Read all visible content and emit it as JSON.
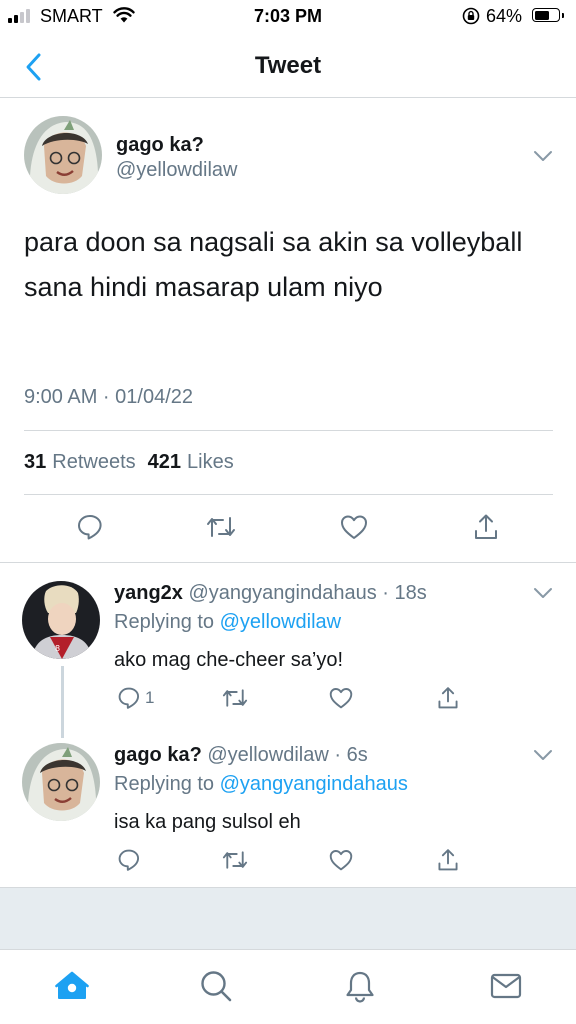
{
  "status_bar": {
    "carrier": "SMART",
    "time": "7:03 PM",
    "battery_percent": "64%",
    "battery_level": 0.64,
    "icons": [
      "signal-icon",
      "wifi-icon",
      "orientation-lock-icon",
      "battery-icon"
    ]
  },
  "nav": {
    "title": "Tweet",
    "back_icon": "chevron-left-icon"
  },
  "main_tweet": {
    "display_name": "gago ka?",
    "handle": "@yellowdilaw",
    "body": "para doon sa nagsali sa akin sa volleyball sana hindi masarap ulam niyo",
    "timestamp": "9:00 AM · 01/04/22",
    "retweets_count": "31",
    "retweets_label": "Retweets",
    "likes_count": "421",
    "likes_label": "Likes"
  },
  "replies": [
    {
      "display_name": "yang2x",
      "handle": "@yangyangindahaus · 18s",
      "replying_prefix": "Replying to ",
      "replying_to": "@yellowdilaw",
      "text": "ako mag che-cheer sa’yo!",
      "reply_count": "1"
    },
    {
      "display_name": "gago ka?",
      "handle": "@yellowdilaw · 6s",
      "replying_prefix": "Replying to ",
      "replying_to": "@yangyangindahaus",
      "text": "isa ka pang sulsol eh",
      "reply_count": ""
    }
  ],
  "tab_bar": {
    "tabs": [
      "home-icon",
      "search-icon",
      "notifications-icon",
      "messages-icon"
    ],
    "active": "home-icon"
  },
  "colors": {
    "accent": "#1da1f2",
    "secondary_text": "#657786",
    "divider": "#d5d9dc",
    "background_gray": "#e6ecf0"
  }
}
